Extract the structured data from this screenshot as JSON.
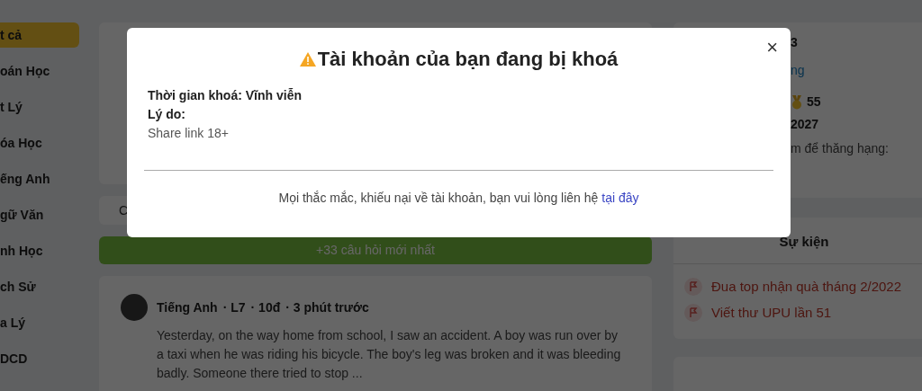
{
  "sidebar": {
    "items": [
      {
        "label": "t cả",
        "selected": true
      },
      {
        "label": "oán Học",
        "selected": false
      },
      {
        "label": "t Lý",
        "selected": false
      },
      {
        "label": "óa Học",
        "selected": false
      },
      {
        "label": "ếng Anh",
        "selected": false
      },
      {
        "label": "gữ Văn",
        "selected": false
      },
      {
        "label": "nh Học",
        "selected": false
      },
      {
        "label": "ch Sử",
        "selected": false
      },
      {
        "label": "a Lý",
        "selected": false
      },
      {
        "label": "DCD",
        "selected": false
      }
    ]
  },
  "filter_bar": {
    "text": "C"
  },
  "new_questions_button": "+33 câu hỏi mới nhất",
  "post": {
    "subject": "Tiếng Anh",
    "level": "· L7",
    "points": "· 10đ",
    "time": "· 3 phút trước",
    "body": "Yesterday, on the way home from school, I saw an accident. A boy was run over by a taxi when he was riding his bicycle. The boy's leg was broken and it was bleeding badly. Someone there tried to stop  ..."
  },
  "profile": {
    "rank": "3",
    "link": "ng",
    "medals": "55",
    "score": "2027",
    "note": "m để thăng hạng:"
  },
  "events": {
    "title": "Sự kiện",
    "items": [
      "Đua top nhận quà tháng 2/2022",
      "Viết thư UPU lần 51"
    ]
  },
  "modal": {
    "title": "Tài khoản của bạn đang bị khoá",
    "lock_time": "Thời gian khoá: Vĩnh viễn",
    "reason_label": "Lý do:",
    "reason": "Share link 18+",
    "contact_text": "Mọi thắc mắc, khiếu nại về tài khoản, bạn vui lòng liên hệ",
    "contact_link": "tại đây",
    "close": "×"
  }
}
